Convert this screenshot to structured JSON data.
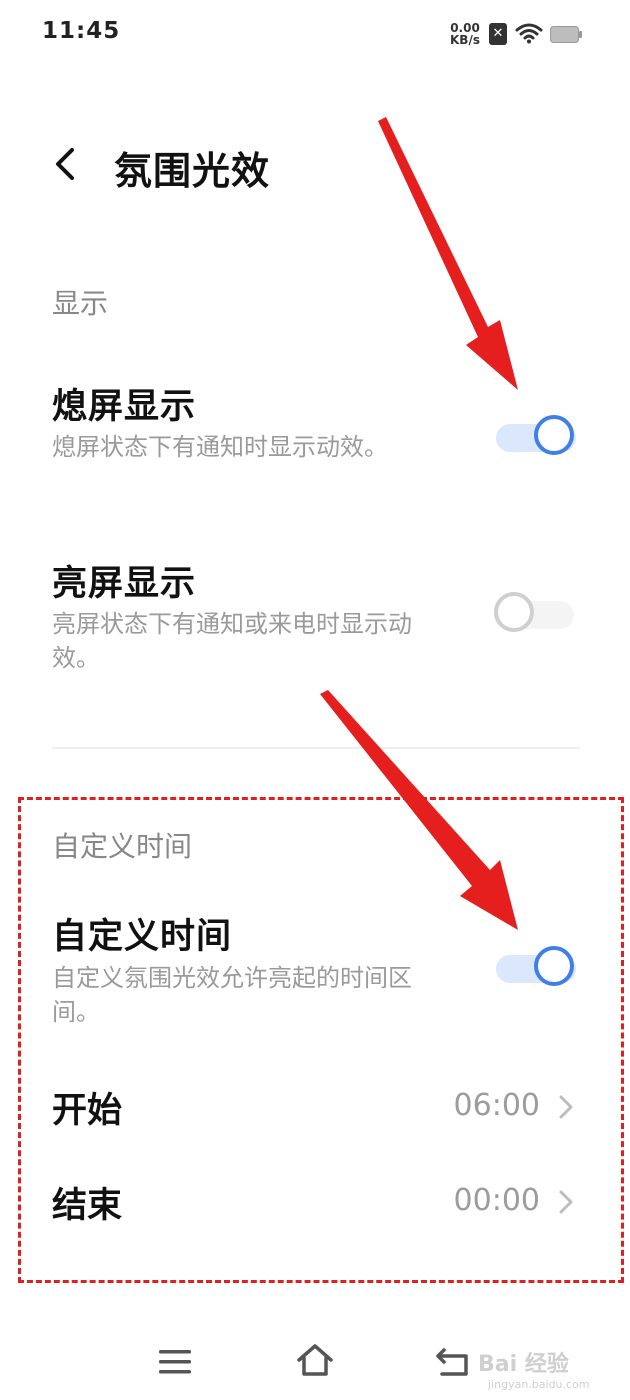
{
  "status_bar": {
    "time": "11:45",
    "net_speed_value": "0.00",
    "net_speed_unit": "KB/s",
    "sim_symbol": "✕"
  },
  "header": {
    "title": "氛围光效"
  },
  "display_section": {
    "header": "显示",
    "items": [
      {
        "title": "熄屏显示",
        "description": "熄屏状态下有通知时显示动效。",
        "enabled": true
      },
      {
        "title": "亮屏显示",
        "description": "亮屏状态下有通知或来电时显示动效。",
        "enabled": false
      }
    ]
  },
  "custom_time_section": {
    "header": "自定义时间",
    "toggle_item": {
      "title": "自定义时间",
      "description": "自定义氛围光效允许亮起的时间区间。",
      "enabled": true
    },
    "start": {
      "label": "开始",
      "value": "06:00"
    },
    "end": {
      "label": "结束",
      "value": "00:00"
    }
  },
  "nav_bar": {
    "icons": [
      "menu-icon",
      "home-icon",
      "back-icon"
    ]
  },
  "watermark": {
    "text": "Bai 经验",
    "sub": "jingyan.baidu.com"
  },
  "colors": {
    "accent": "#3f7fe6",
    "annotation_red": "#e02020"
  }
}
